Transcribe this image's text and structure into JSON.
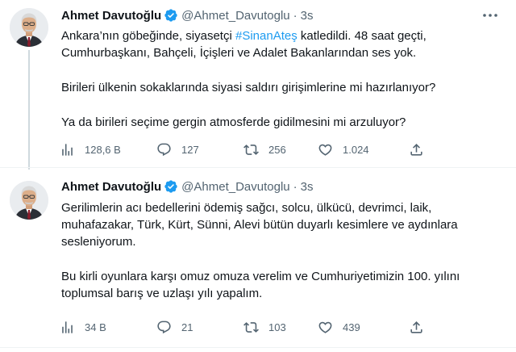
{
  "colors": {
    "accent": "#1d9bf0",
    "text": "#0f1419",
    "muted": "#536471",
    "divider": "#eff3f4"
  },
  "icons": [
    "verified-badge-icon",
    "more-options-icon",
    "views-icon",
    "reply-icon",
    "retweet-icon",
    "like-icon",
    "share-icon"
  ],
  "tweets": [
    {
      "name": "Ahmet Davutoğlu",
      "handle": "@Ahmet_Davutoglu",
      "dot": "·",
      "time": "3s",
      "more": "···",
      "body": {
        "p1_pre": "Ankara’nın göbeğinde, siyasetçi ",
        "p1_hashtag": "#SinanAteş",
        "p1_post": " katledildi. 48 saat geçti, Cumhurbaşkanı, Bahçeli, İçişleri ve Adalet Bakanlarından ses yok.",
        "p2": "Birileri ülkenin sokaklarında siyasi saldırı girişimlerine mi hazırlanıyor?",
        "p3": "Ya da birileri seçime gergin atmosferde gidilmesini mi arzuluyor?"
      },
      "stats": {
        "views": "128,6 B",
        "replies": "127",
        "retweets": "256",
        "likes": "1.024"
      }
    },
    {
      "name": "Ahmet Davutoğlu",
      "handle": "@Ahmet_Davutoglu",
      "dot": "·",
      "time": "3s",
      "body": {
        "p1": "Gerilimlerin acı bedellerini ödemiş sağcı, solcu, ülkücü, devrimci, laik, muhafazakar, Türk, Kürt, Sünni, Alevi bütün duyarlı kesimlere ve aydınlara sesleniyorum.",
        "p2": "Bu kirli oyunlara karşı omuz omuza verelim ve Cumhuriyetimizin 100. yılını toplumsal barış ve uzlaşı yılı yapalım."
      },
      "stats": {
        "views": "34 B",
        "replies": "21",
        "retweets": "103",
        "likes": "439"
      }
    }
  ]
}
